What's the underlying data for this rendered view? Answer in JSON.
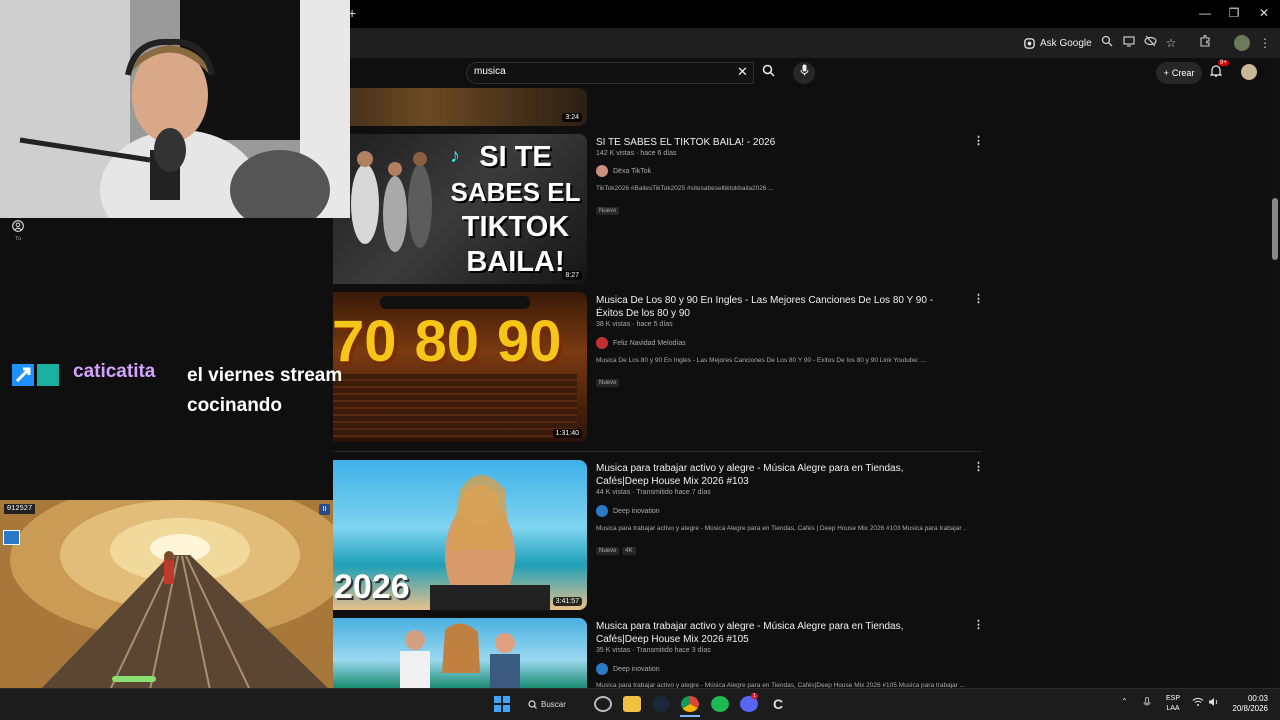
{
  "browser": {
    "new_tab": "+",
    "ask_google": "Ask Google",
    "window_controls": {
      "minimize": "—",
      "restore": "❐",
      "close": "✕"
    }
  },
  "youtube": {
    "search_value": "musica",
    "create_label": "Crear",
    "notif_count": "9+",
    "results": [
      {
        "duration": "3:24"
      },
      {
        "title": "SI TE SABES EL TIKTOK BAILA! - 2026",
        "meta": "142 K vistas · hace 6 días",
        "channel": "Dëxa TikTok",
        "desc": "TikTok2026 #BailesTikTok2025 #sitesabeseltiktokbaila2026 ...",
        "badges": [
          "Nuevo"
        ],
        "duration": "8:27",
        "thumb_text": [
          "SI TE",
          "SABES EL",
          "TIKTOK",
          "BAILA!"
        ]
      },
      {
        "title": "Musica De Los 80 y 90 En Ingles - Las Mejores Canciones De Los 80 Y 90 - Éxitos De los 80 y 90",
        "meta": "38 K vistas · hace 5 días",
        "channel": "Feliz Navidad Melodías",
        "desc": "Musica De Los 80 y 90 En Ingles - Las Mejores Canciones De Los 80 Y 90 - Éxitos De los 80 y 90 Link Youtube: ...",
        "badges": [
          "Nuevo"
        ],
        "duration": "1:31:40",
        "thumb_text": [
          "70",
          "80",
          "90"
        ]
      },
      {
        "title": "Musica para trabajar activo y alegre - Música Alegre para en Tiendas, Cafés|Deep House Mix 2026 #103",
        "meta": "44 K vistas · Transmitido hace 7 días",
        "channel": "Deep inovation",
        "desc": "Musica para trabajar activo y alegre - Música Alegre para en Tiendas, Cafés | Deep House Mix 2026 #103 Musica para trabajar ...",
        "badges": [
          "Nuevo",
          "4K"
        ],
        "duration": "3:41:57",
        "thumb_text": [
          "2026"
        ]
      },
      {
        "title": "Musica para trabajar activo y alegre - Música Alegre para en Tiendas, Cafés|Deep House Mix 2026 #105",
        "meta": "35 K vistas · Transmitido hace 3 días",
        "channel": "Deep inovation",
        "desc": "Musica para trabajar activo y alegre - Música Alegre para en Tiendas, Cafés|Deep House Mix 2026 #105 Musica para trabajar ..."
      }
    ]
  },
  "stream": {
    "user_label": "Tú",
    "chat_user": "caticatita",
    "chat_message": "el viernes stream cocinando",
    "game_score": "012527"
  },
  "taskbar": {
    "search_label": "Buscar",
    "lang_top": "ESP",
    "lang_bottom": "LAA",
    "time": "00:03",
    "date": "20/8/2026",
    "discord_badge": "1"
  }
}
